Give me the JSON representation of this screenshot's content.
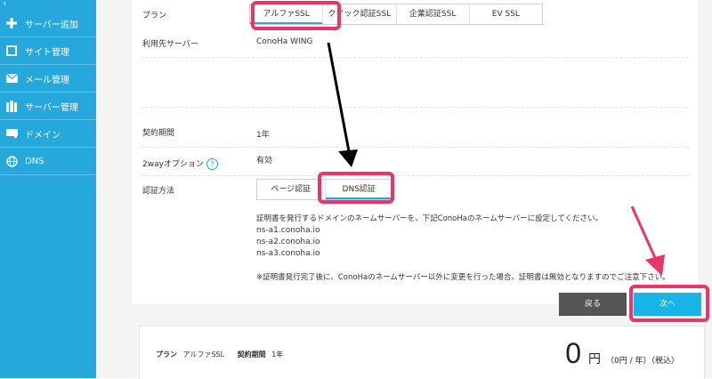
{
  "sidebar": {
    "back_glyph": "‹",
    "items": [
      {
        "label": "サーバー追加",
        "icon": "plus-icon"
      },
      {
        "label": "サイト管理",
        "icon": "window-icon"
      },
      {
        "label": "メール管理",
        "icon": "mail-icon"
      },
      {
        "label": "サーバー管理",
        "icon": "server-icon"
      },
      {
        "label": "ドメイン",
        "icon": "domain-icon"
      },
      {
        "label": "DNS",
        "icon": "globe-icon"
      }
    ]
  },
  "form": {
    "plan_label": "プラン",
    "plan_tabs": [
      "アルファSSL",
      "クイック認証SSL",
      "企業認証SSL",
      "EV SSL"
    ],
    "server_label": "利用先サーバー",
    "server_value": "ConoHa WING",
    "period_label": "契約期間",
    "period_value": "1年",
    "twoway_label": "2wayオプション",
    "twoway_help": "?",
    "twoway_value": "有効",
    "auth_label": "認証方法",
    "auth_tabs": [
      "ページ認証",
      "DNS認証"
    ],
    "dns_note": "証明書を発行するドメインのネームサーバーを、下記ConoHaのネームサーバーに設定してください。",
    "nameservers": [
      "ns-a1.conoha.io",
      "ns-a2.conoha.io",
      "ns-a3.conoha.io"
    ],
    "warning": "※証明書発行完了後に、ConoHaのネームサーバー以外に変更を行った場合、証明書は無効となりますのでご注意下さい。"
  },
  "buttons": {
    "back": "戻る",
    "next": "次へ"
  },
  "summary": {
    "plan_label": "プラン",
    "plan_value": "アルファSSL",
    "period_label": "契約期間",
    "period_value": "1年",
    "price": "0",
    "currency": "円",
    "price_detail": "（0円 / 年）（税込）"
  },
  "colors": {
    "sidebar": "#27a8dd",
    "highlight": "#e8356a",
    "next_button": "#19b4e6",
    "back_button": "#555555"
  }
}
